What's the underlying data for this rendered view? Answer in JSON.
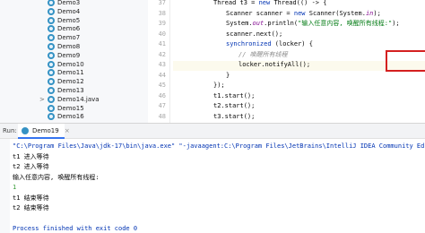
{
  "project_tree": {
    "items": [
      {
        "label": "Demo3",
        "expand": ""
      },
      {
        "label": "Demo4",
        "expand": ""
      },
      {
        "label": "Demo5",
        "expand": ""
      },
      {
        "label": "Demo6",
        "expand": ""
      },
      {
        "label": "Demo7",
        "expand": ""
      },
      {
        "label": "Demo8",
        "expand": ""
      },
      {
        "label": "Demo9",
        "expand": ""
      },
      {
        "label": "Demo10",
        "expand": ""
      },
      {
        "label": "Demo11",
        "expand": ""
      },
      {
        "label": "Demo12",
        "expand": ""
      },
      {
        "label": "Demo13",
        "expand": ""
      },
      {
        "label": "Demo14.java",
        "expand": ">"
      },
      {
        "label": "Demo15",
        "expand": ""
      },
      {
        "label": "Demo16",
        "expand": ""
      }
    ]
  },
  "editor": {
    "line_numbers": [
      "37",
      "38",
      "39",
      "40",
      "41",
      "42",
      "43",
      "44",
      "45",
      "46",
      "47",
      "48",
      "49",
      "50"
    ],
    "lines": [
      {
        "t": [
          {
            "c": "",
            "s": "Thread t3 = "
          },
          {
            "c": "kw",
            "s": "new"
          },
          {
            "c": "",
            "s": " Thread(() -> {"
          }
        ],
        "indent": 0
      },
      {
        "t": [
          {
            "c": "",
            "s": "Scanner scanner = "
          },
          {
            "c": "kw",
            "s": "new"
          },
          {
            "c": "",
            "s": " Scanner(System."
          },
          {
            "c": "fld",
            "s": "in"
          },
          {
            "c": "",
            "s": ");"
          }
        ],
        "indent": 1
      },
      {
        "t": [
          {
            "c": "",
            "s": "System."
          },
          {
            "c": "fld",
            "s": "out"
          },
          {
            "c": "",
            "s": ".println("
          },
          {
            "c": "str",
            "s": "\"输入任意内容, 唤醒所有线程:\""
          },
          {
            "c": "",
            "s": ");"
          }
        ],
        "indent": 1
      },
      {
        "t": [
          {
            "c": "",
            "s": "scanner.next();"
          }
        ],
        "indent": 1
      },
      {
        "t": [
          {
            "c": "kw",
            "s": "synchronized"
          },
          {
            "c": "",
            "s": " (locker) {"
          }
        ],
        "indent": 1
      },
      {
        "t": [
          {
            "c": "cmt",
            "s": "// 唤醒所有线程"
          }
        ],
        "indent": 2
      },
      {
        "t": [
          {
            "c": "",
            "s": "locker.notifyAll();"
          }
        ],
        "indent": 2
      },
      {
        "t": [
          {
            "c": "",
            "s": "}"
          }
        ],
        "indent": 1
      },
      {
        "t": [
          {
            "c": "",
            "s": "});"
          }
        ],
        "indent": 0
      },
      {
        "t": [
          {
            "c": "",
            "s": "t1.start();"
          }
        ],
        "indent": 0
      },
      {
        "t": [
          {
            "c": "",
            "s": "t2.start();"
          }
        ],
        "indent": 0
      },
      {
        "t": [
          {
            "c": "",
            "s": "t3.start();"
          }
        ],
        "indent": 0
      },
      {
        "t": [
          {
            "c": "",
            "s": "}"
          }
        ],
        "indent": -1
      },
      {
        "t": [
          {
            "c": "",
            "s": ""
          }
        ],
        "indent": 0
      }
    ]
  },
  "run_panel": {
    "run_label": "Run:",
    "tab_label": "Demo19",
    "tab_close": "×",
    "lines": [
      {
        "text": "\"C:\\Program Files\\Java\\jdk-17\\bin\\java.exe\" \"-javaagent:C:\\Program Files\\JetBrains\\IntelliJ IDEA Community Edition",
        "kind": "cmd"
      },
      {
        "text": "t1 进入等待",
        "kind": "out"
      },
      {
        "text": "t2 进入等待",
        "kind": "out"
      },
      {
        "text": "输入任意内容, 唤醒所有线程:",
        "kind": "out"
      },
      {
        "text": "1",
        "kind": "input"
      },
      {
        "text": "t1 结束等待",
        "kind": "out"
      },
      {
        "text": "t2 结束等待",
        "kind": "out"
      },
      {
        "text": "",
        "kind": "blank"
      },
      {
        "text": "Process finished with exit code 0",
        "kind": "fin"
      }
    ]
  },
  "colors": {
    "keyword": "#0033b3",
    "string": "#067d17",
    "field": "#871094",
    "comment": "#8c8c8c",
    "highlight_border": "#d42020",
    "class_icon": "#3592c4"
  }
}
